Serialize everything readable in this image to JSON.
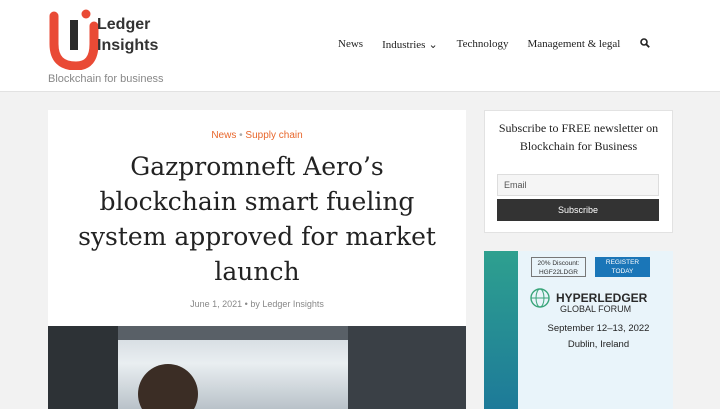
{
  "header": {
    "logo_line1": "Ledger",
    "logo_line2": "Insights",
    "tagline": "Blockchain for business",
    "nav": [
      "News",
      "Industries",
      "Technology",
      "Management & legal"
    ]
  },
  "article": {
    "category1": "News",
    "category2": "Supply chain",
    "title": "Gazpromneft Aero’s blockchain smart fueling system approved for market launch",
    "date": "June 1, 2021",
    "author": "by Ledger Insights"
  },
  "newsletter": {
    "title": "Subscribe to FREE newsletter on Blockchain for Business",
    "email_placeholder": "Email",
    "button": "Subscribe"
  },
  "ad": {
    "discount_line1": "20% Discount:",
    "discount_line2": "HGF22LDGR",
    "register_line1": "REGISTER",
    "register_line2": "TODAY",
    "brand": "HYPERLEDGER",
    "brand_sub": "GLOBAL FORUM",
    "dates": "September 12–13, 2022",
    "city": "Dublin, Ireland"
  },
  "colors": {
    "accent": "#e8672c",
    "logo_red": "#e94a35",
    "dark_button": "#333333"
  }
}
